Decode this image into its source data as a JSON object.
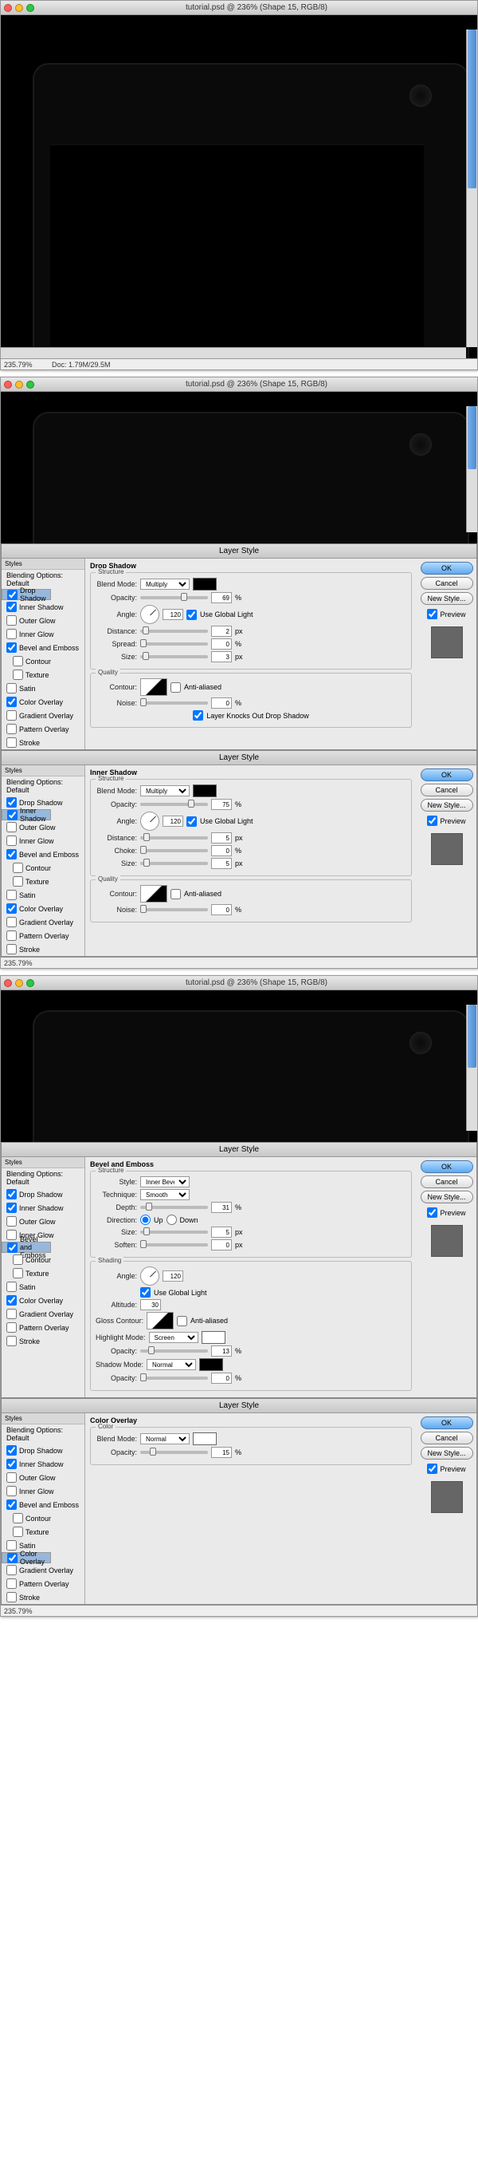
{
  "window": {
    "title": "tutorial.psd @ 236% (Shape 15, RGB/8)"
  },
  "status": {
    "zoom": "235.79%",
    "doc": "Doc: 1.79M/29.5M"
  },
  "ls_title": "Layer Style",
  "styles_hdr": "Styles",
  "blend_opt": "Blending Options: Default",
  "items": {
    "drop": "Drop Shadow",
    "innerShadow": "Inner Shadow",
    "outerGlow": "Outer Glow",
    "innerGlow": "Inner Glow",
    "bevel": "Bevel and Emboss",
    "contour": "Contour",
    "texture": "Texture",
    "satin": "Satin",
    "colorOv": "Color Overlay",
    "gradOv": "Gradient Overlay",
    "pattOv": "Pattern Overlay",
    "stroke": "Stroke"
  },
  "btns": {
    "ok": "OK",
    "cancel": "Cancel",
    "new": "New Style...",
    "preview": "Preview"
  },
  "common": {
    "blendMode": "Blend Mode:",
    "opacity": "Opacity:",
    "angle": "Angle:",
    "useGlobal": "Use Global Light",
    "distance": "Distance:",
    "spread": "Spread:",
    "size": "Size:",
    "choke": "Choke:",
    "contour": "Contour:",
    "anti": "Anti-aliased",
    "noise": "Noise:",
    "px": "px",
    "pct": "%",
    "structure": "Structure",
    "quality": "Quality",
    "shading": "Shading",
    "color": "Color"
  },
  "drop": {
    "title": "Drop Shadow",
    "mode": "Multiply",
    "opacity": "69",
    "angle": "120",
    "distance": "2",
    "spread": "0",
    "size": "3",
    "noise": "0",
    "knock": "Layer Knocks Out Drop Shadow"
  },
  "inner": {
    "title": "Inner Shadow",
    "mode": "Multiply",
    "opacity": "75",
    "angle": "120",
    "distance": "5",
    "choke": "0",
    "size": "5",
    "noise": "0"
  },
  "bevel": {
    "title": "Bevel and Emboss",
    "style": "Style:",
    "styleV": "Inner Bevel",
    "tech": "Technique:",
    "techV": "Smooth",
    "depth": "Depth:",
    "depthV": "31",
    "dir": "Direction:",
    "up": "Up",
    "down": "Down",
    "sizeV": "5",
    "soften": "Soften:",
    "softenV": "0",
    "angle": "120",
    "alt": "Altitude:",
    "altV": "30",
    "gloss": "Gloss Contour:",
    "hi": "Highlight Mode:",
    "hiV": "Screen",
    "hiOp": "13",
    "sh": "Shadow Mode:",
    "shV": "Normal",
    "shOp": "0"
  },
  "colorOv": {
    "title": "Color Overlay",
    "mode": "Normal",
    "opacity": "15"
  }
}
